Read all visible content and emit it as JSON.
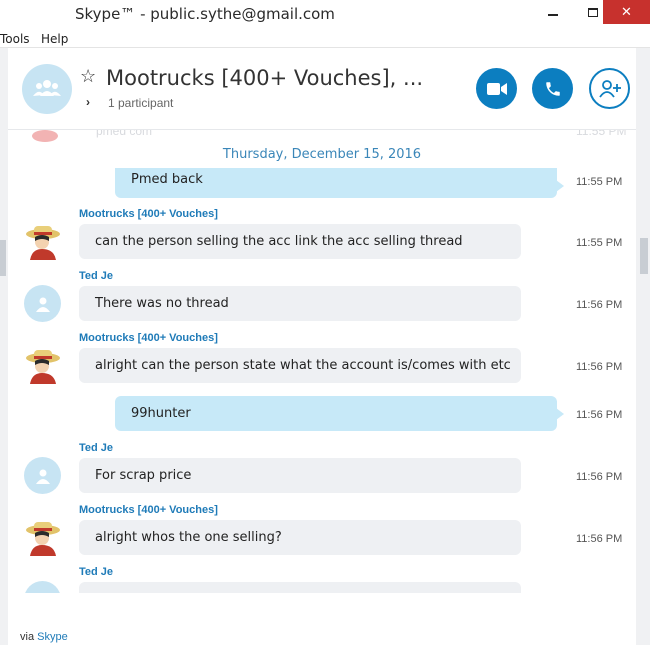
{
  "window": {
    "title": "Skype™ - public.sythe@gmail.com",
    "close_glyph": "✕"
  },
  "menu": {
    "items": [
      {
        "label": "Tools"
      },
      {
        "label": "Help"
      }
    ]
  },
  "header": {
    "title": "Mootrucks [400+ Vouches], ...",
    "participants": "1 participant",
    "icons": {
      "group_avatar": "group-icon",
      "favorite": "star-icon",
      "expand": "chevron-right-icon",
      "video": "video-camera-icon",
      "call": "phone-icon",
      "add": "add-person-icon"
    }
  },
  "chat": {
    "partial_top_text": "pmed com",
    "partial_top_time": "11:55 PM",
    "date": "Thursday, December 15, 2016",
    "messages": [
      {
        "direction": "out",
        "text": "Pmed back",
        "time": "11:55 PM"
      },
      {
        "direction": "in",
        "sender": "Mootrucks [400+ Vouches]",
        "text": "can the person selling the acc link the acc selling thread",
        "time": "11:55 PM",
        "avatar": "pirate-avatar"
      },
      {
        "direction": "in",
        "sender": "Ted Je",
        "text": "There was no thread",
        "time": "11:56 PM",
        "avatar": "default-user-avatar"
      },
      {
        "direction": "in",
        "sender": "Mootrucks [400+ Vouches]",
        "text": "alright can the person state what the account is/comes with etc",
        "time": "11:56 PM",
        "avatar": "pirate-avatar"
      },
      {
        "direction": "out",
        "text": "99hunter",
        "time": "11:56 PM"
      },
      {
        "direction": "in",
        "sender": "Ted Je",
        "text": "For scrap price",
        "time": "11:56 PM",
        "avatar": "default-user-avatar"
      },
      {
        "direction": "in",
        "sender": "Mootrucks [400+ Vouches]",
        "text": "alright whos the one selling?",
        "time": "11:56 PM",
        "avatar": "pirate-avatar"
      },
      {
        "direction": "in",
        "sender": "Ted Je",
        "text": "",
        "time": "",
        "avatar": "default-user-avatar"
      }
    ]
  },
  "footer": {
    "via_prefix": "via",
    "via_link": "Skype"
  },
  "colors": {
    "accent": "#0c7ec0",
    "sender_name": "#1f7bb8",
    "incoming_bubble": "#eef0f3",
    "outgoing_bubble": "#c7e9f8",
    "avatar_bg": "#c7e4f3",
    "close_button": "#c7312d"
  }
}
